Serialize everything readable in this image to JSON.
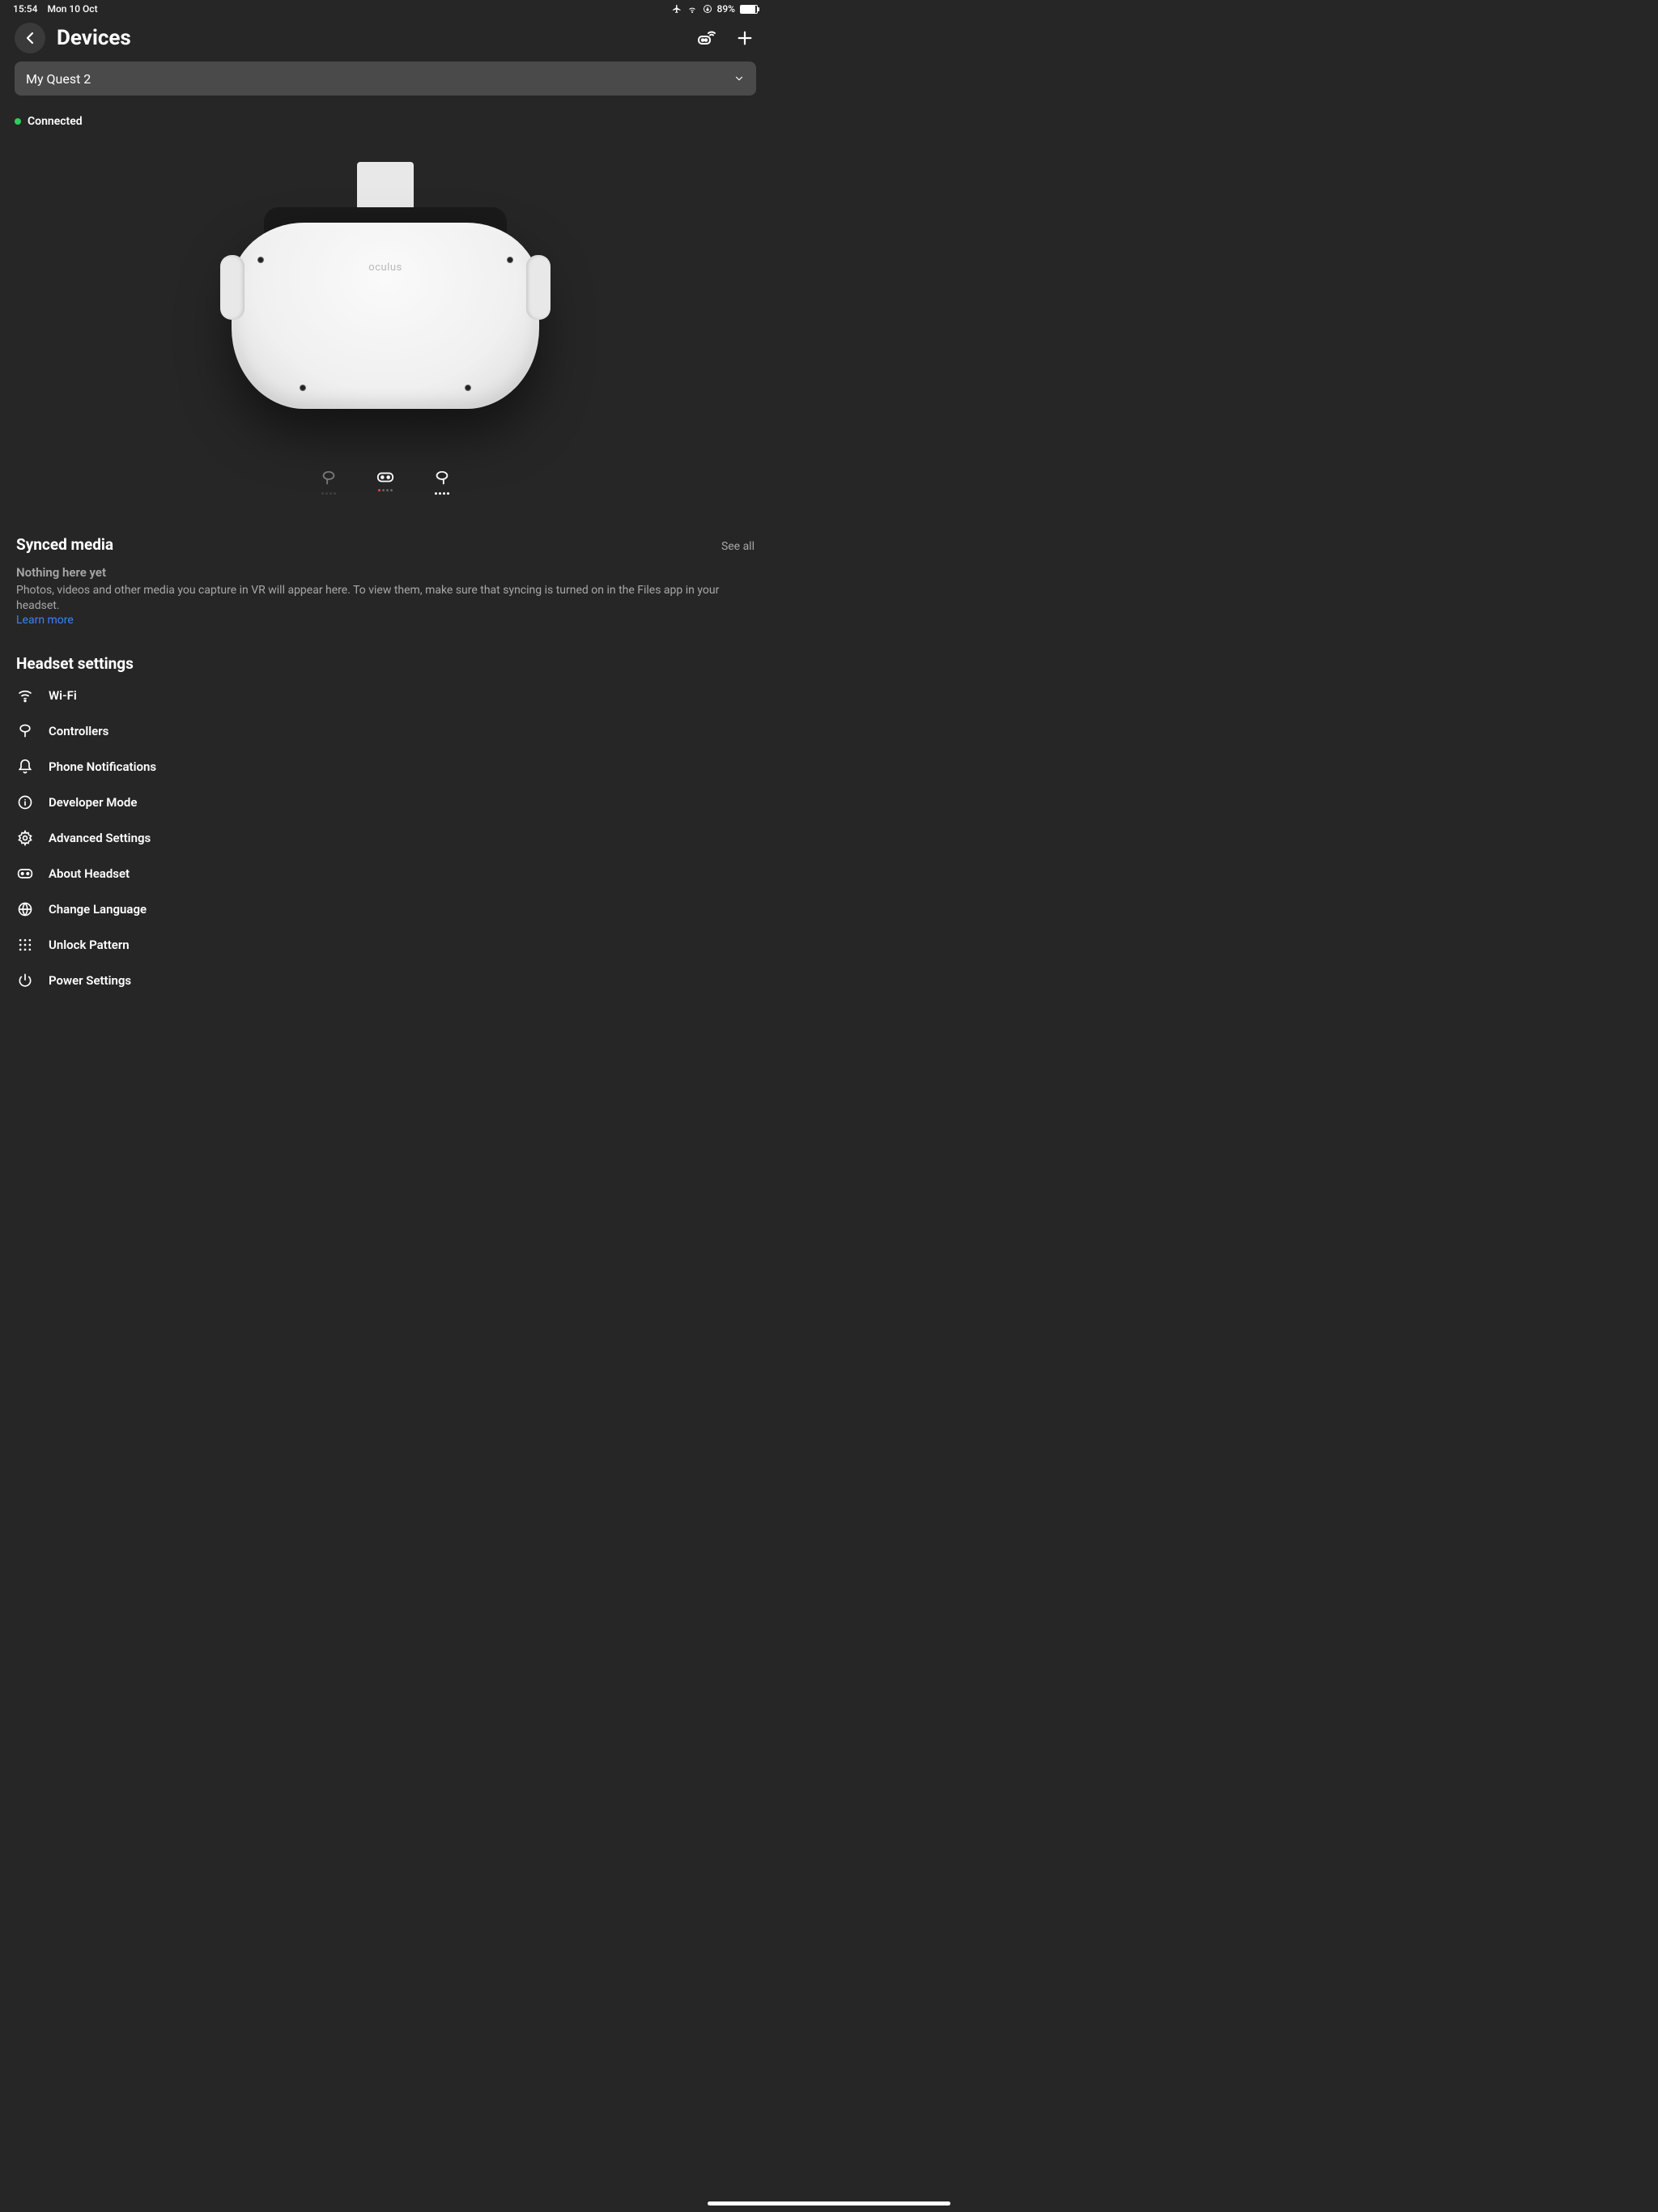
{
  "status_bar": {
    "time": "15:54",
    "date": "Mon 10 Oct",
    "battery_pct": "89%"
  },
  "header": {
    "title": "Devices"
  },
  "device_selector": {
    "selected": "My Quest 2"
  },
  "connection": {
    "status": "Connected"
  },
  "headset": {
    "brand": "oculus"
  },
  "synced_media": {
    "title": "Synced media",
    "see_all": "See all",
    "empty_title": "Nothing here yet",
    "empty_desc": "Photos, videos and other media you capture in VR will appear here. To view them, make sure that syncing is turned on in the Files app in your headset.",
    "learn_more": "Learn more"
  },
  "settings": {
    "title": "Headset settings",
    "items": [
      {
        "id": "wifi",
        "label": "Wi-Fi"
      },
      {
        "id": "controllers",
        "label": "Controllers"
      },
      {
        "id": "phone-notifications",
        "label": "Phone Notifications"
      },
      {
        "id": "developer-mode",
        "label": "Developer Mode"
      },
      {
        "id": "advanced-settings",
        "label": "Advanced Settings"
      },
      {
        "id": "about-headset",
        "label": "About Headset"
      },
      {
        "id": "change-language",
        "label": "Change Language"
      },
      {
        "id": "unlock-pattern",
        "label": "Unlock Pattern"
      },
      {
        "id": "power-settings",
        "label": "Power Settings"
      }
    ]
  }
}
